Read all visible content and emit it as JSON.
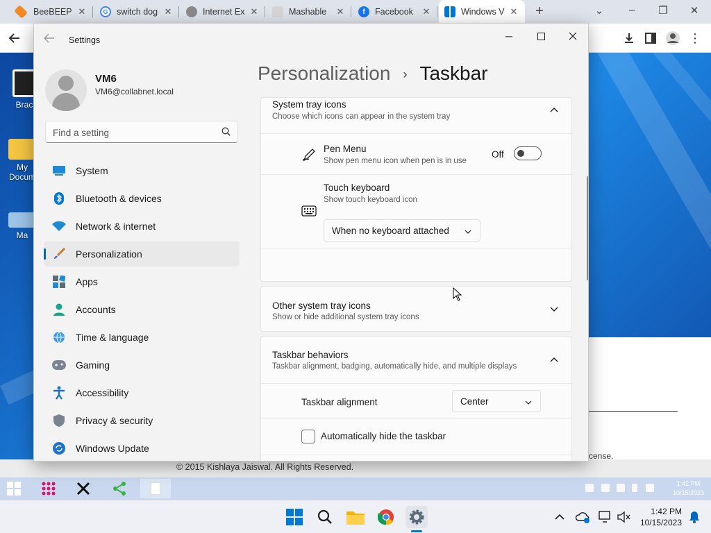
{
  "browser": {
    "tabs": [
      {
        "title": "BeeBEEP (R",
        "icon": "beebeep-icon",
        "color": "#f08a24"
      },
      {
        "title": "switch dog",
        "icon": "google-icon",
        "color": "#4285f4"
      },
      {
        "title": "Internet Ex",
        "icon": "globe-icon",
        "color": "#6b6b6b"
      },
      {
        "title": "Mashable",
        "icon": "mashable-icon",
        "color": "#c8c8c8"
      },
      {
        "title": "Facebook",
        "icon": "facebook-icon",
        "color": "#1877f2"
      },
      {
        "title": "Windows V",
        "icon": "windows-icon",
        "color": "#0078d4"
      }
    ],
    "new_tab": "+"
  },
  "desktop": {
    "icons": [
      {
        "label": "Brack"
      },
      {
        "label": "My Docum"
      },
      {
        "label": "Ma"
      }
    ],
    "copyright": "© 2015 Kishlaya Jaiswal. All Rights Reserved.",
    "license_text": "cense.",
    "remote_clock": {
      "time": "1:42 PM",
      "date": "10/15/2023"
    }
  },
  "settings": {
    "window_title": "Settings",
    "user": {
      "name": "VM6",
      "email": "VM6@collabnet.local"
    },
    "search_placeholder": "Find a setting",
    "nav": [
      {
        "label": "System",
        "icon": "system-icon"
      },
      {
        "label": "Bluetooth & devices",
        "icon": "bluetooth-icon"
      },
      {
        "label": "Network & internet",
        "icon": "wifi-icon"
      },
      {
        "label": "Personalization",
        "icon": "brush-icon",
        "selected": true
      },
      {
        "label": "Apps",
        "icon": "apps-icon"
      },
      {
        "label": "Accounts",
        "icon": "accounts-icon"
      },
      {
        "label": "Time & language",
        "icon": "globe-clock-icon"
      },
      {
        "label": "Gaming",
        "icon": "gamepad-icon"
      },
      {
        "label": "Accessibility",
        "icon": "accessibility-icon"
      },
      {
        "label": "Privacy & security",
        "icon": "shield-icon"
      },
      {
        "label": "Windows Update",
        "icon": "update-icon"
      }
    ],
    "breadcrumb": {
      "parent": "Personalization",
      "separator": "›",
      "current": "Taskbar"
    },
    "system_tray": {
      "title": "System tray icons",
      "subtitle": "Choose which icons can appear in the system tray",
      "pen_menu": {
        "title": "Pen Menu",
        "subtitle": "Show pen menu icon when pen is in use",
        "state": "Off"
      },
      "touch_keyboard": {
        "title": "Touch keyboard",
        "subtitle": "Show touch keyboard icon",
        "value": "When no keyboard attached"
      }
    },
    "other_tray": {
      "title": "Other system tray icons",
      "subtitle": "Show or hide additional system tray icons"
    },
    "behaviors": {
      "title": "Taskbar behaviors",
      "subtitle": "Taskbar alignment, badging, automatically hide, and multiple displays",
      "alignment": {
        "label": "Taskbar alignment",
        "value": "Center"
      },
      "autohide": {
        "label": "Automatically hide the taskbar",
        "checked": false
      }
    }
  },
  "host_taskbar": {
    "time": "1:42 PM",
    "date": "10/15/2023"
  },
  "colors": {
    "accent": "#0067c0",
    "toggle_off": "#444444"
  }
}
